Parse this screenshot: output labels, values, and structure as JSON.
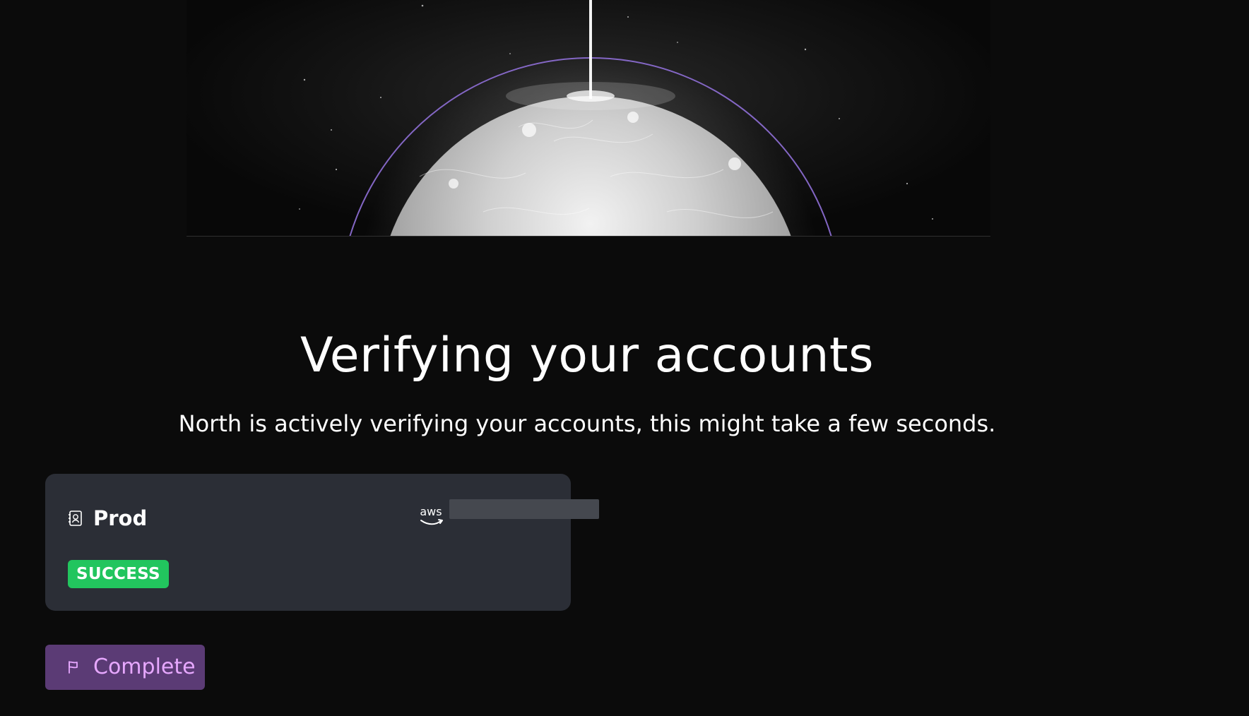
{
  "hero": {
    "image_alt": "Glowing planet rising over horizon"
  },
  "page": {
    "title": "Verifying your accounts",
    "subtitle": "North is actively verifying your accounts, this might take a few seconds."
  },
  "accounts": [
    {
      "name": "Prod",
      "provider": "aws",
      "account_id": "",
      "status": "SUCCESS",
      "icon": "contact-book-icon"
    }
  ],
  "actions": {
    "complete_label": "Complete",
    "complete_icon": "flag-icon"
  },
  "colors": {
    "background": "#0b0b0b",
    "card": "#2b2e36",
    "success": "#22c55e",
    "button": "#5b3b75",
    "button_text": "#e7a8ff",
    "halo": "#8a6ccf"
  }
}
